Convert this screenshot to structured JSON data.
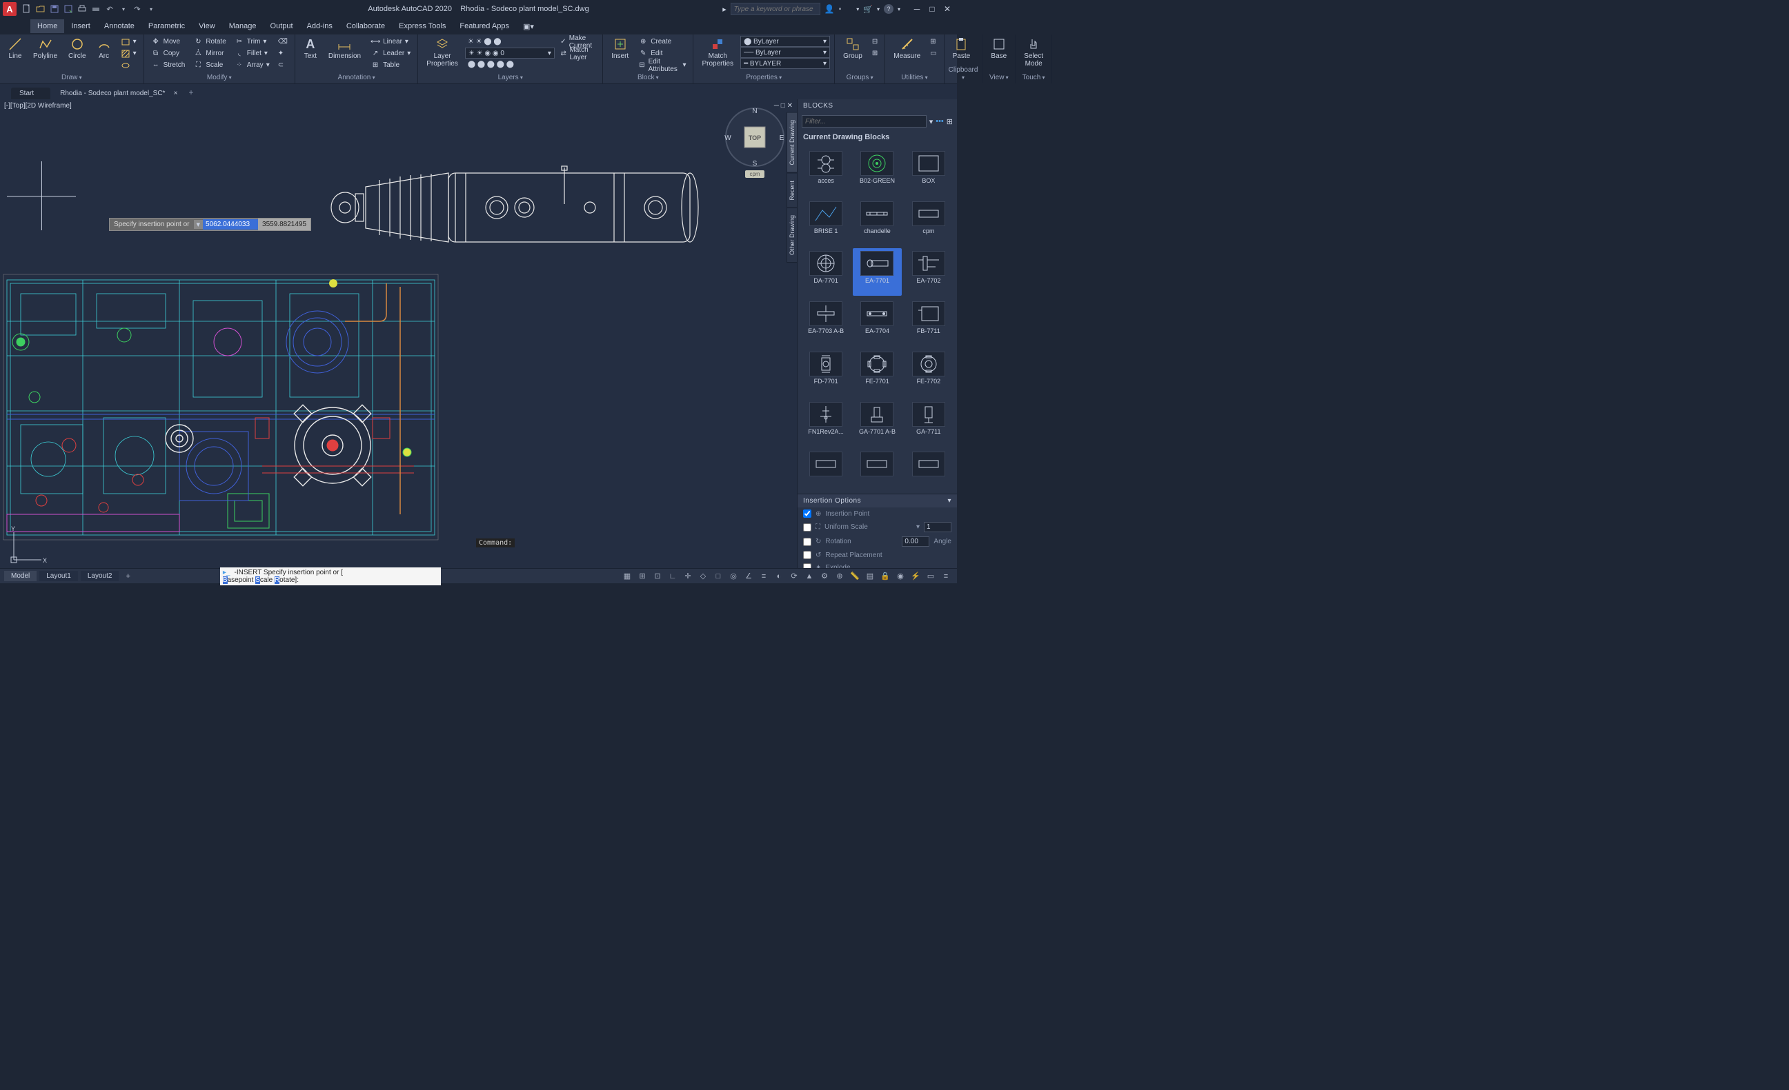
{
  "app": {
    "logo": "A",
    "product": "Autodesk AutoCAD 2020",
    "file": "Rhodia - Sodeco plant model_SC.dwg",
    "search_placeholder": "Type a keyword or phrase"
  },
  "qat": [
    "new",
    "open",
    "save",
    "saveas",
    "plot",
    "undo",
    "redo"
  ],
  "menu": {
    "items": [
      "Home",
      "Insert",
      "Annotate",
      "Parametric",
      "View",
      "Manage",
      "Output",
      "Add-ins",
      "Collaborate",
      "Express Tools",
      "Featured Apps"
    ],
    "active": "Home"
  },
  "ribbon": {
    "draw": {
      "title": "Draw",
      "big": [
        "Line",
        "Polyline",
        "Circle",
        "Arc"
      ]
    },
    "modify": {
      "title": "Modify",
      "items": [
        "Move",
        "Rotate",
        "Trim",
        "Copy",
        "Mirror",
        "Fillet",
        "Stretch",
        "Scale",
        "Array"
      ]
    },
    "annotation": {
      "title": "Annotation",
      "big": [
        "Text",
        "Dimension"
      ],
      "items": [
        "Linear",
        "Leader",
        "Table"
      ]
    },
    "layers": {
      "title": "Layers",
      "big": "Layer Properties",
      "items": [
        "Create",
        "Edit",
        "Make Current",
        "Edit Attributes",
        "Match Layer"
      ],
      "current": "0"
    },
    "block": {
      "title": "Block",
      "big": "Insert",
      "items": [
        "Create",
        "Edit",
        "Edit Attributes"
      ]
    },
    "properties": {
      "title": "Properties",
      "big": "Match Properties",
      "layer": "ByLayer",
      "ltype": "ByLayer",
      "lweight": "BYLAYER"
    },
    "groups": {
      "title": "Groups",
      "big": "Group"
    },
    "utilities": {
      "title": "Utilities",
      "big": "Measure"
    },
    "clipboard": {
      "title": "Clipboard",
      "big": "Paste"
    },
    "view": {
      "title": "View",
      "big": "Base"
    },
    "touch": {
      "title": "Touch",
      "big": "Select Mode"
    }
  },
  "doc_tabs": {
    "tabs": [
      "Start",
      "Rhodia - Sodeco plant model_SC*"
    ],
    "active": 1
  },
  "viewport": {
    "label": "[-][Top][2D Wireframe]",
    "cube": "TOP",
    "cube_dirs": {
      "n": "N",
      "s": "S",
      "e": "E",
      "w": "W"
    },
    "wcs": "cpm"
  },
  "prompt": {
    "text": "Specify insertion point or",
    "x": "5062.0444033",
    "y": "3559.8821495"
  },
  "cmd": {
    "label": "Command:",
    "line1": "-INSERT Specify insertion point or [",
    "line2_parts": [
      "B",
      "asepoint ",
      "S",
      "cale ",
      "R",
      "otate]:"
    ]
  },
  "blocks": {
    "title": "BLOCKS",
    "filter_placeholder": "Filter...",
    "section": "Current Drawing Blocks",
    "vtabs": [
      "Current Drawing",
      "Recent",
      "Other Drawing"
    ],
    "items": [
      "acces",
      "B02-GREEN",
      "BOX",
      "BRISE 1",
      "chandelle",
      "cpm",
      "DA-7701",
      "EA-7701",
      "EA-7702",
      "EA-7703 A-B",
      "EA-7704",
      "FB-7711",
      "FD-7701",
      "FE-7701",
      "FE-7702",
      "FN1Rev2A...",
      "GA-7701 A-B",
      "GA-7711",
      "",
      "",
      ""
    ],
    "selected": "EA-7701",
    "insertion": {
      "header": "Insertion Options",
      "point": "Insertion Point",
      "scale": "Uniform Scale",
      "scale_val": "1",
      "rotation": "Rotation",
      "rot_val": "0.00",
      "rot_unit": "Angle",
      "repeat": "Repeat Placement",
      "explode": "Explode"
    }
  },
  "status": {
    "tabs": [
      "Model",
      "Layout1",
      "Layout2"
    ],
    "active": "Model"
  }
}
